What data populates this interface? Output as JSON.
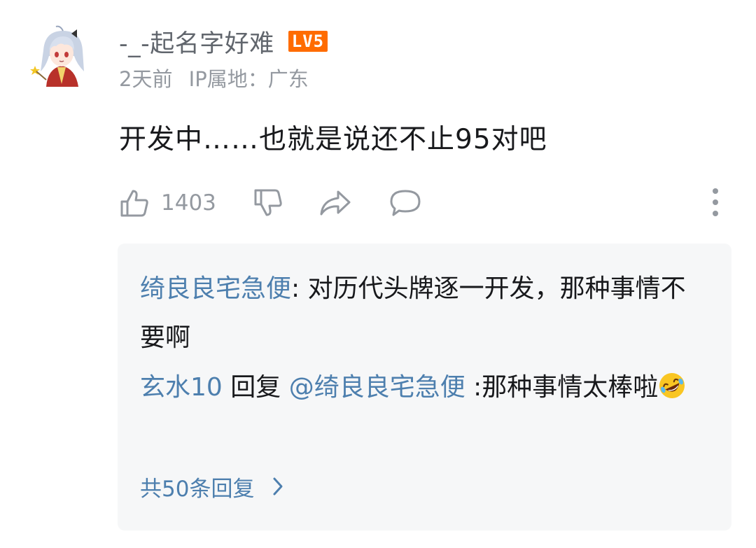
{
  "comment": {
    "username": "-_-起名字好难",
    "level_badge": "LV5",
    "time": "2天前",
    "ip_location": "IP属地：广东",
    "content": "开发中……也就是说还不止95对吧",
    "like_count": "1403"
  },
  "replies": [
    {
      "author": "绮良良宅急便",
      "separator": ": ",
      "text": "对历代头牌逐一开发，那种事情不要啊"
    },
    {
      "author": "玄水10",
      "reply_word": " 回复 ",
      "mention": "@绮良良宅急便",
      "text": " :那种事情太棒啦"
    }
  ],
  "more_replies_label": "共50条回复",
  "colors": {
    "username": "#61666d",
    "meta": "#9499a0",
    "text": "#18191c",
    "link_blue": "#4d7fae",
    "reply_bg": "#f6f7f8",
    "level_badge": "#ff6c00"
  },
  "icons": [
    "avatar-image",
    "like-icon",
    "dislike-icon",
    "share-icon",
    "reply-icon",
    "more-vertical-icon",
    "rofl-emoji",
    "chevron-right-icon"
  ]
}
